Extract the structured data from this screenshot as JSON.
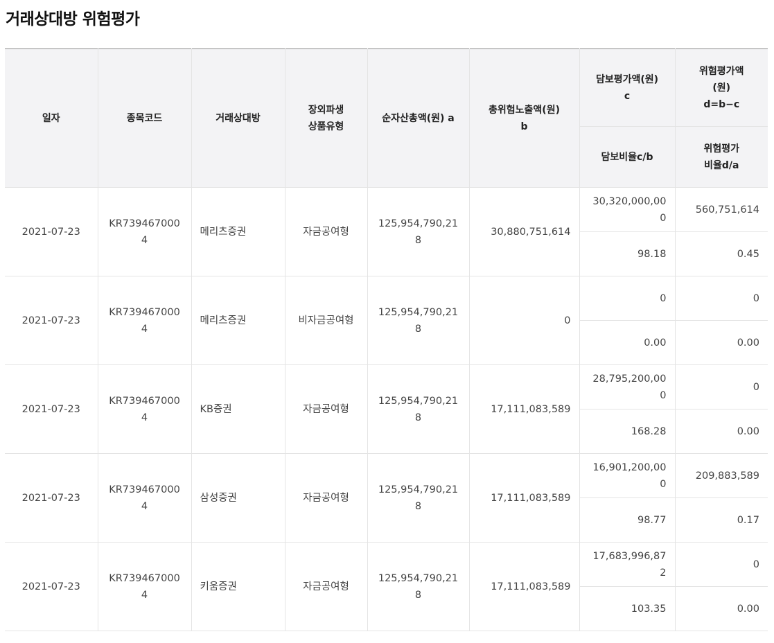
{
  "page": {
    "title": "거래상대방 위험평가"
  },
  "table": {
    "headers": {
      "date": "일자",
      "code": "종목코드",
      "counterparty": "거래상대방",
      "product_line1": "장외파생",
      "product_line2": "상품유형",
      "net_assets": "순자산총액(원) a",
      "exposure_line1": "총위험노출액(원)",
      "exposure_line2": "b",
      "collateral_value_line1": "담보평가액(원)",
      "collateral_value_line2": "c",
      "risk_value_line1": "위험평가액",
      "risk_value_line2": "(원)",
      "risk_value_line3": "d=b−c",
      "collateral_ratio": "담보비율c/b",
      "risk_ratio_line1": "위험평가",
      "risk_ratio_line2": "비율d/a"
    },
    "rows": [
      {
        "date": "2021-07-23",
        "code_line1": "KR739467000",
        "code_line2": "4",
        "counterparty": "메리츠증권",
        "product": "자금공여형",
        "net_assets": "125,954,790,218",
        "exposure": "30,880,751,614",
        "collateral_value": "30,320,000,000",
        "risk_value": "560,751,614",
        "collateral_ratio": "98.18",
        "risk_ratio": "0.45"
      },
      {
        "date": "2021-07-23",
        "code_line1": "KR739467000",
        "code_line2": "4",
        "counterparty": "메리츠증권",
        "product": "비자금공여형",
        "net_assets": "125,954,790,218",
        "exposure": "0",
        "collateral_value": "0",
        "risk_value": "0",
        "collateral_ratio": "0.00",
        "risk_ratio": "0.00"
      },
      {
        "date": "2021-07-23",
        "code_line1": "KR739467000",
        "code_line2": "4",
        "counterparty": "KB증권",
        "product": "자금공여형",
        "net_assets": "125,954,790,218",
        "exposure": "17,111,083,589",
        "collateral_value": "28,795,200,000",
        "risk_value": "0",
        "collateral_ratio": "168.28",
        "risk_ratio": "0.00"
      },
      {
        "date": "2021-07-23",
        "code_line1": "KR739467000",
        "code_line2": "4",
        "counterparty": "삼성증권",
        "product": "자금공여형",
        "net_assets": "125,954,790,218",
        "exposure": "17,111,083,589",
        "collateral_value": "16,901,200,000",
        "risk_value": "209,883,589",
        "collateral_ratio": "98.77",
        "risk_ratio": "0.17"
      },
      {
        "date": "2021-07-23",
        "code_line1": "KR739467000",
        "code_line2": "4",
        "counterparty": "키움증권",
        "product": "자금공여형",
        "net_assets": "125,954,790,218",
        "exposure": "17,111,083,589",
        "collateral_value": "17,683,996,872",
        "risk_value": "0",
        "collateral_ratio": "103.35",
        "risk_ratio": "0.00"
      }
    ]
  }
}
